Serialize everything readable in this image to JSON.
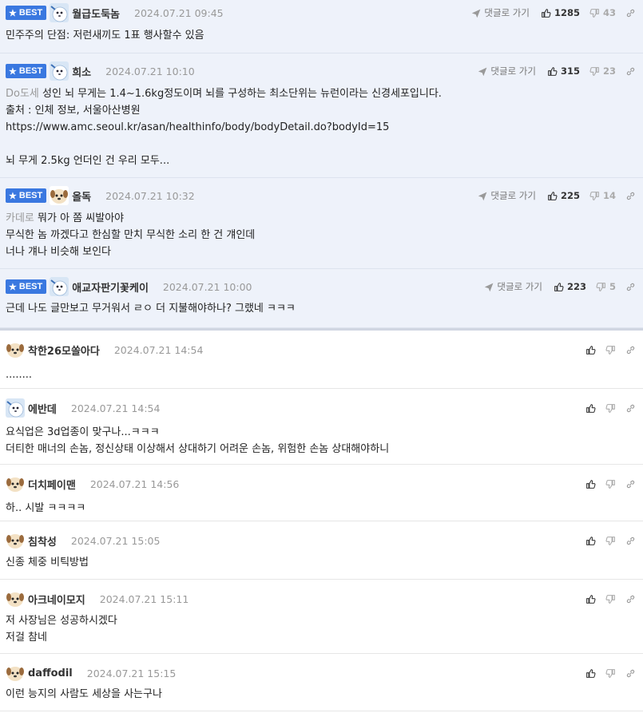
{
  "ui": {
    "best_label": "BEST",
    "reply_link": "댓글로 가기",
    "colors": {
      "badge": "#3a78e0",
      "best_bg": "#eef2fa",
      "date": "#999999"
    }
  },
  "best_comments": [
    {
      "nick": "월급도둑놈",
      "date": "2024.07.21 09:45",
      "up": "1285",
      "down": "43",
      "avatar": "blue-seal-avatar",
      "lines": [
        "민주주의 단점: 저런새끼도 1표 행사할수 있음"
      ]
    },
    {
      "nick": "희소",
      "date": "2024.07.21 10:10",
      "up": "315",
      "down": "23",
      "avatar": "blue-seal-avatar",
      "quote": "Do도세",
      "lines": [
        "성인 뇌 무게는 1.4~1.6kg정도이며 뇌를 구성하는 최소단위는 뉴런이라는 신경세포입니다.",
        "출처 : 인체 정보, 서울아산병원",
        "https://www.amc.seoul.kr/asan/healthinfo/body/bodyDetail.do?bodyId=15",
        "",
        "뇌 무게 2.5kg 언더인 건 우리 모두..."
      ]
    },
    {
      "nick": "올독",
      "date": "2024.07.21 10:32",
      "up": "225",
      "down": "14",
      "avatar": "puppy-avatar",
      "quote": "카데로",
      "lines": [
        "뭐가 아 쫌 씨발아야",
        "무식한 놈 까겠다고 한심할 만치 무식한 소리 한 건 걔인데",
        "너나 걔나 비슷해 보인다"
      ]
    },
    {
      "nick": "애교자판기꽃케이",
      "date": "2024.07.21 10:00",
      "up": "223",
      "down": "5",
      "avatar": "blue-seal-avatar",
      "lines": [
        "근데 나도 글만보고 무거워서 ㄹㅇ 더 지불해야하나? 그랬네 ㅋㅋㅋ"
      ]
    }
  ],
  "comments": [
    {
      "nick": "착한26모쏠아다",
      "date": "2024.07.21 14:54",
      "avatar": "puppy-avatar",
      "lines": [
        "........"
      ]
    },
    {
      "nick": "에반데",
      "date": "2024.07.21 14:54",
      "avatar": "blue-seal-avatar",
      "lines": [
        "요식업은 3d업종이 맞구나...ㅋㅋㅋ",
        "더티한 매너의 손놈, 정신상태 이상해서 상대하기 어려운 손놈, 위험한 손놈 상대해야하니"
      ]
    },
    {
      "nick": "더치페이맨",
      "date": "2024.07.21 14:56",
      "avatar": "puppy-avatar",
      "lines": [
        "하.. 시발 ㅋㅋㅋㅋ"
      ]
    },
    {
      "nick": "침착성",
      "date": "2024.07.21 15:05",
      "avatar": "puppy-avatar",
      "lines": [
        "신종 체중 비틱방법"
      ]
    },
    {
      "nick": "아크네이모지",
      "date": "2024.07.21 15:11",
      "avatar": "puppy-avatar",
      "lines": [
        "저 사장님은 성공하시겠다",
        "저걸 참네"
      ]
    },
    {
      "nick": "daffodil",
      "date": "2024.07.21 15:15",
      "avatar": "puppy-avatar",
      "lines": [
        "이런 능지의 사람도 세상을 사는구나"
      ]
    }
  ]
}
